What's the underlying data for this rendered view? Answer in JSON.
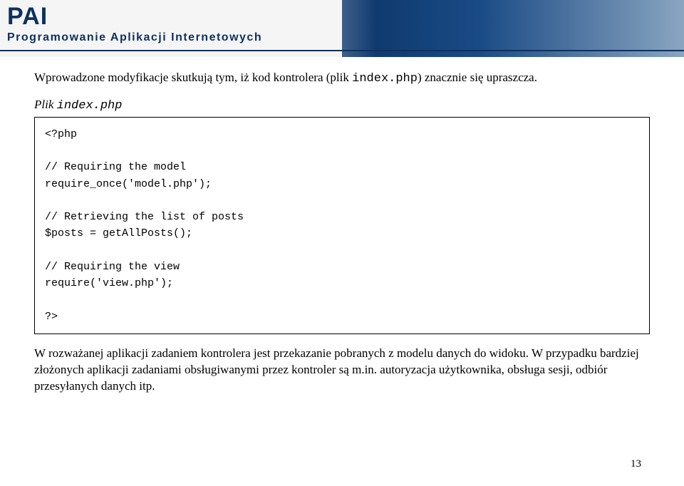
{
  "header": {
    "title": "PAI",
    "subtitle": "Programowanie Aplikacji Internetowych"
  },
  "para1_a": "Wprowadzone modyfikacje skutkują tym, iż kod kontrolera (plik ",
  "para1_code": "index.php",
  "para1_b": ") znacznie się upraszcza.",
  "file_label_a": "Plik ",
  "file_label_code": "index.php",
  "code": "<?php\n\n// Requiring the model\nrequire_once('model.php');\n\n// Retrieving the list of posts\n$posts = getAllPosts();\n\n// Requiring the view\nrequire('view.php');\n\n?>",
  "para2": "W rozważanej aplikacji zadaniem kontrolera jest przekazanie pobranych z modelu danych do widoku. W przypadku bardziej złożonych aplikacji zadaniami obsługiwanymi przez kontroler są m.in. autoryzacja użytkownika, obsługa sesji, odbiór przesyłanych danych itp.",
  "page_number": "13"
}
